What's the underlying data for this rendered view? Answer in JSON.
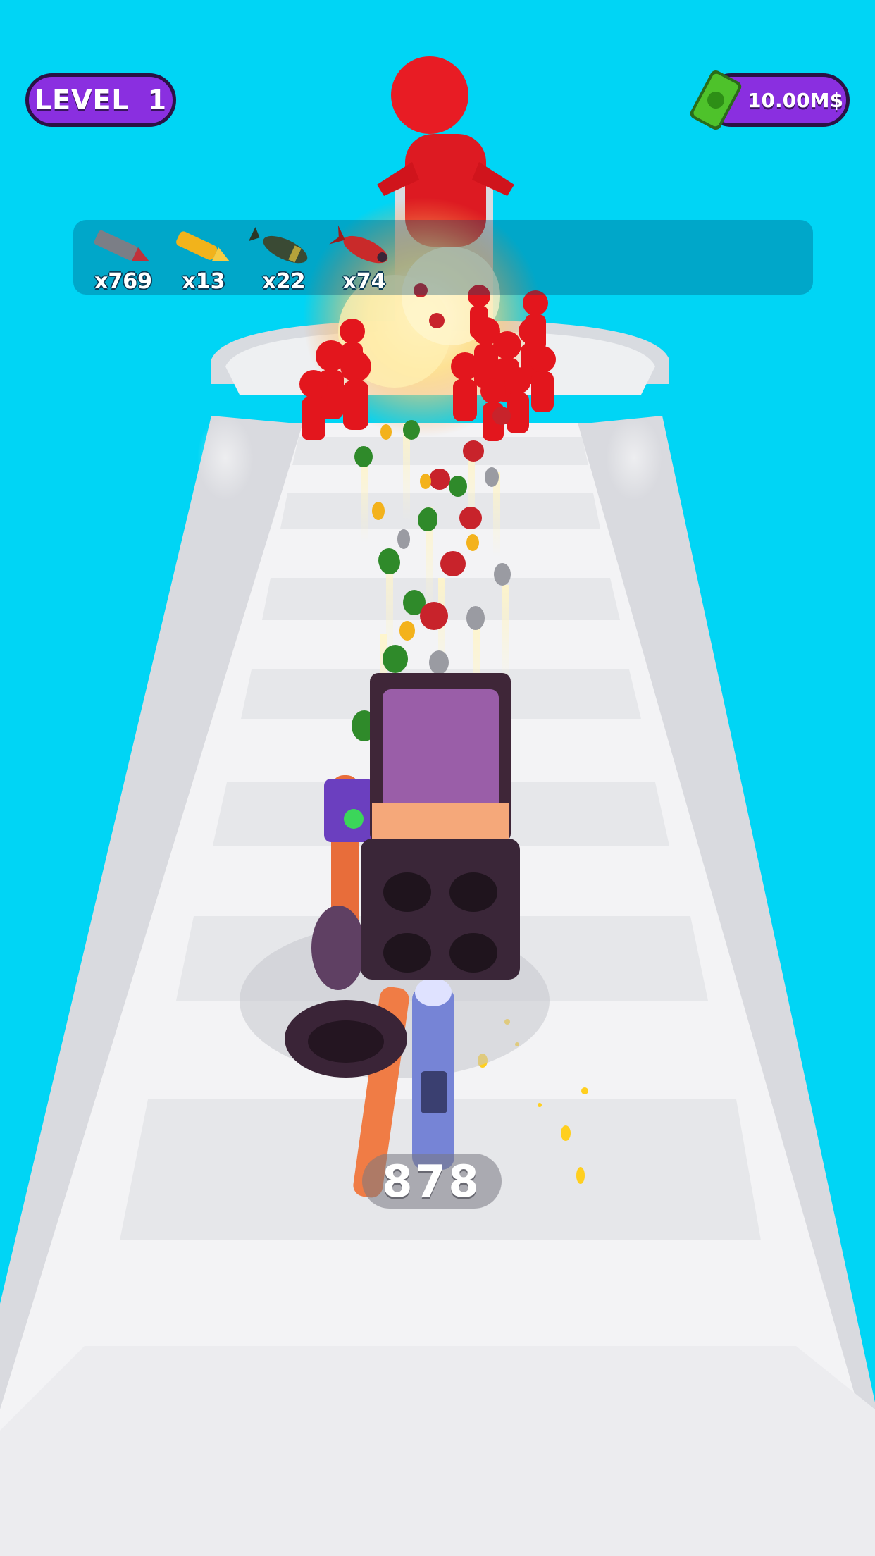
{
  "hud": {
    "level_label": "LEVEL",
    "level_number": "1",
    "cash": "10.00M$"
  },
  "ammo": [
    {
      "type": "bullet-icon",
      "count": "x769",
      "color": "#c0313a"
    },
    {
      "type": "gold-bullet-icon",
      "count": "x13",
      "color": "#f2b31b"
    },
    {
      "type": "bomb-icon",
      "count": "x22",
      "color": "#3a4a34"
    },
    {
      "type": "rocket-icon",
      "count": "x74",
      "color": "#c92a2a"
    }
  ],
  "weapon": {
    "ammo_count": "878"
  },
  "colors": {
    "sky": "#00d5f5",
    "track": "#f2f2f4",
    "enemy": "#e8141a",
    "hud_purple": "#8a2fe0",
    "cash_green": "#4ec22b"
  }
}
